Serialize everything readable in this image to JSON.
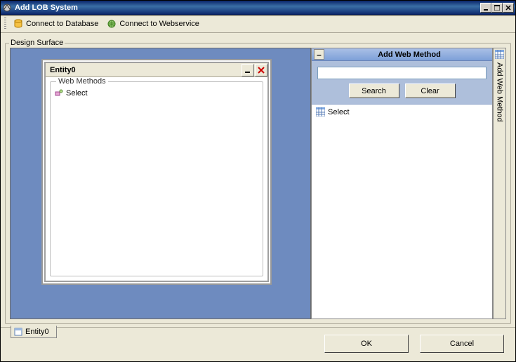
{
  "window": {
    "title": "Add LOB System"
  },
  "toolbar": {
    "connect_db": "Connect to Database",
    "connect_ws": "Connect to Webservice"
  },
  "design_surface": {
    "label": "Design Surface"
  },
  "entity": {
    "title": "Entity0",
    "web_methods_label": "Web Methods",
    "items": [
      "Select"
    ]
  },
  "tabs": {
    "items": [
      "Entity0"
    ]
  },
  "right_panel": {
    "title": "Add Web Method",
    "search_placeholder": "",
    "search_btn": "Search",
    "clear_btn": "Clear",
    "results": [
      "Select"
    ],
    "side_tab": "Add Web Method"
  },
  "dialog": {
    "ok": "OK",
    "cancel": "Cancel"
  }
}
